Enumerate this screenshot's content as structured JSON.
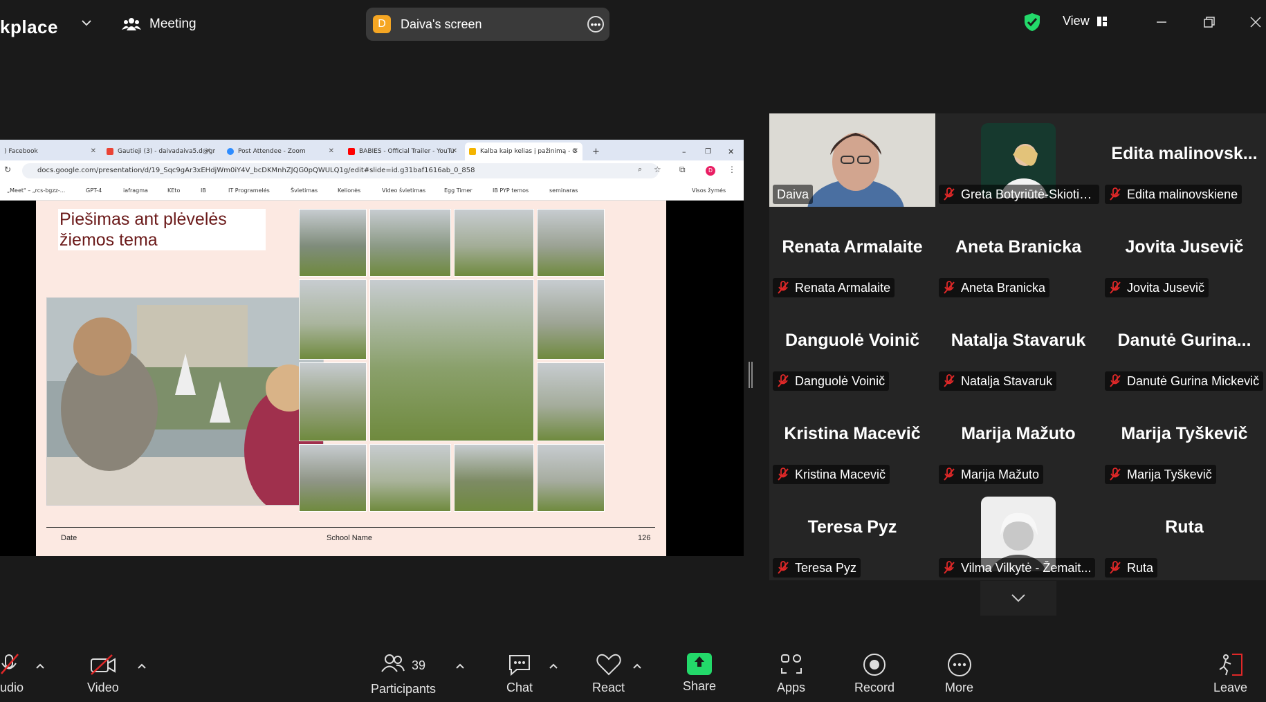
{
  "topbar": {
    "app_name": "kplace",
    "meeting_label": "Meeting",
    "screen_badge": "D",
    "screen_label": "Daiva's screen",
    "view_label": "View"
  },
  "browser": {
    "tabs": [
      {
        "label": ") Facebook",
        "color": "#1877f2"
      },
      {
        "label": "Gautieji (3) - daivadaiva5.d@gm",
        "color": "#ea4335"
      },
      {
        "label": "Post Attendee - Zoom",
        "color": "#2d8cff"
      },
      {
        "label": "BABIES - Official Trailer - YouTu",
        "color": "#ff0000"
      },
      {
        "label": "Kalba kaip kelias į pažinimą - G",
        "color": "#f4b400"
      }
    ],
    "url": "docs.google.com/presentation/d/19_Sqc9gAr3xEHdjWm0iY4V_bcDKMnhZJQG0pQWULQ1g/edit#slide=id.g31baf1616ab_0_858",
    "profile_initial": "D",
    "bookmarks": [
      "„Meet\" – „rcs-bgzz-...",
      "GPT-4",
      "iafragma",
      "KEto",
      "IB",
      "IT Programelės",
      "Švietimas",
      "Kelionės",
      "Video švietimas",
      "Egg Timer",
      "IB PYP temos",
      "seminaras",
      "Visos žymės"
    ]
  },
  "slide": {
    "title_line1": "Piešimas ant plėvelės",
    "title_line2": "žiemos tema",
    "footer_date": "Date",
    "footer_school": "School Name",
    "footer_page": "126"
  },
  "gallery": {
    "tiles": [
      {
        "name": "",
        "label": "Daiva",
        "muted": false,
        "video": true,
        "active": true
      },
      {
        "name": "",
        "label": "Greta Botyriūtė-Skiotie...",
        "muted": true,
        "avatar": true
      },
      {
        "name": "Edita  malinovsk...",
        "label": "Edita malinovskiene",
        "muted": true
      },
      {
        "name": "Renata Armalaite",
        "label": "Renata Armalaite",
        "muted": true
      },
      {
        "name": "Aneta Branicka",
        "label": "Aneta Branicka",
        "muted": true
      },
      {
        "name": "Jovita Jusevič",
        "label": "Jovita Jusevič",
        "muted": true
      },
      {
        "name": "Danguolė Voinič",
        "label": "Danguolė Voinič",
        "muted": true
      },
      {
        "name": "Natalja Stavaruk",
        "label": "Natalja Stavaruk",
        "muted": true
      },
      {
        "name": "Danutė  Gurina...",
        "label": "Danutė Gurina Mickevič",
        "muted": true
      },
      {
        "name": "Kristina Macevič",
        "label": "Kristina Macevič",
        "muted": true
      },
      {
        "name": "Marija Mažuto",
        "label": "Marija Mažuto",
        "muted": true
      },
      {
        "name": "Marija Tyškevič",
        "label": "Marija Tyškevič",
        "muted": true
      },
      {
        "name": "Teresa Pyz",
        "label": "Teresa Pyz",
        "muted": true
      },
      {
        "name": "",
        "label": "Vilma Vilkytė - Žemait...",
        "muted": true,
        "avatar": true
      },
      {
        "name": "Ruta",
        "label": "Ruta",
        "muted": true
      }
    ]
  },
  "toolbar": {
    "audio": "udio",
    "video": "Video",
    "participants": "Participants",
    "participants_count": "39",
    "chat": "Chat",
    "react": "React",
    "share": "Share",
    "apps": "Apps",
    "record": "Record",
    "more": "More",
    "leave": "Leave"
  },
  "colors": {
    "accent_green": "#23d96a",
    "mute_red": "#e02828",
    "share_green": "#23d96a"
  }
}
